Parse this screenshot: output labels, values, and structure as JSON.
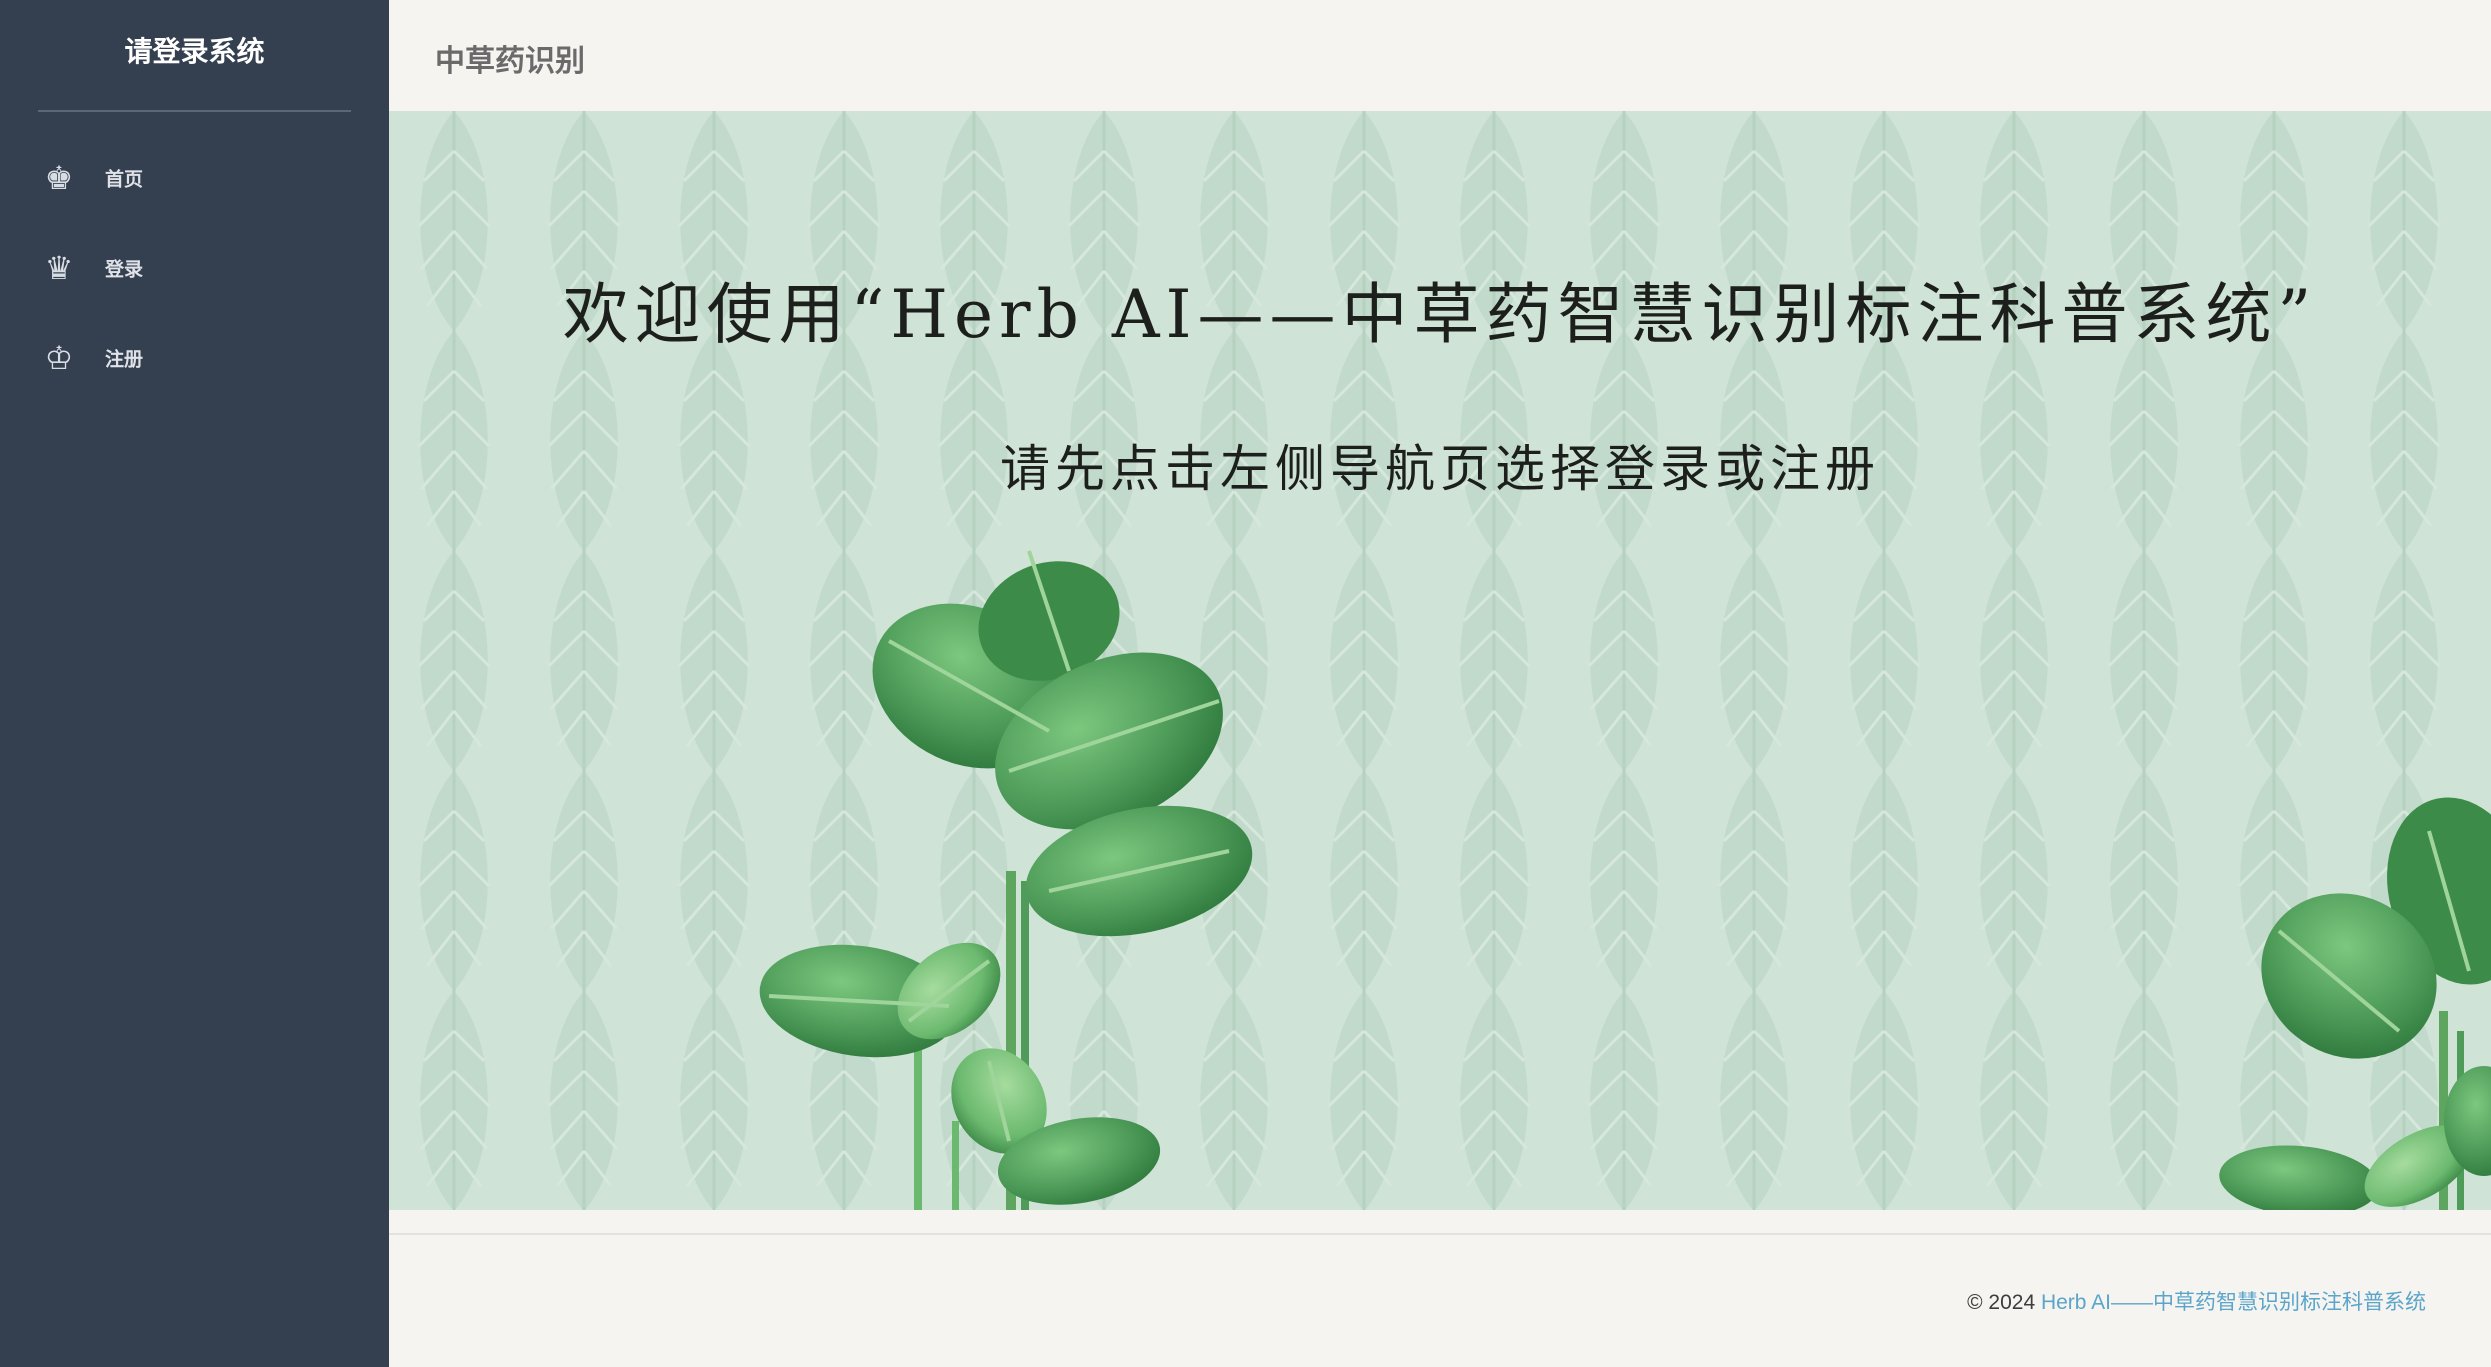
{
  "sidebar": {
    "title": "请登录系统",
    "items": [
      {
        "label": "首页",
        "icon": "crown-icon"
      },
      {
        "label": "登录",
        "icon": "crown-icon"
      },
      {
        "label": "注册",
        "icon": "crown-icon"
      }
    ]
  },
  "header": {
    "title": "中草药识别"
  },
  "hero": {
    "title": "欢迎使用“Herb AI——中草药智慧识别标注科普系统”",
    "subtitle": "请先点击左侧导航页选择登录或注册"
  },
  "footer": {
    "copyright": "© 2024 ",
    "link_text": "Herb AI——中草药智慧识别标注科普系统"
  },
  "colors": {
    "sidebar_bg": "#343f50",
    "hero_bg": "#cfe3d6",
    "leaf": "#4f9c5a",
    "footer_link": "#5aa5c9"
  }
}
